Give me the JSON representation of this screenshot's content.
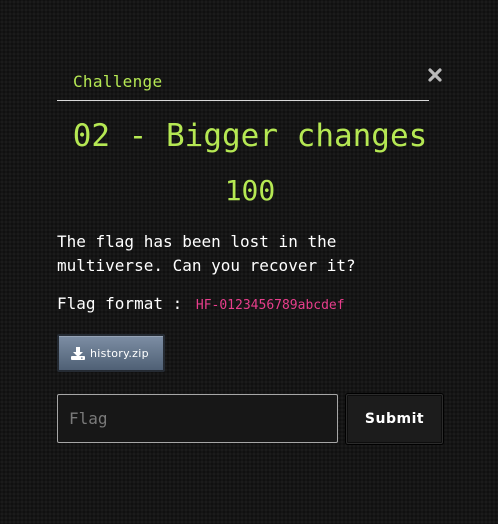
{
  "modal": {
    "tab_label": "Challenge",
    "close_icon": "close-x-icon",
    "challenge_name": "02 - Bigger changes",
    "challenge_value": "100",
    "description": "The flag has been lost in the multiverse. Can you recover it?",
    "flag_format_label": "Flag format :",
    "flag_format_value": "HF-0123456789abcdef",
    "file": {
      "icon": "download-icon",
      "name": "history.zip"
    },
    "flag_input": {
      "placeholder": "Flag",
      "value": ""
    },
    "submit_label": "Submit"
  },
  "colors": {
    "accent": "#b5e853",
    "flag_code": "#e83e8c",
    "background": "#151515"
  }
}
